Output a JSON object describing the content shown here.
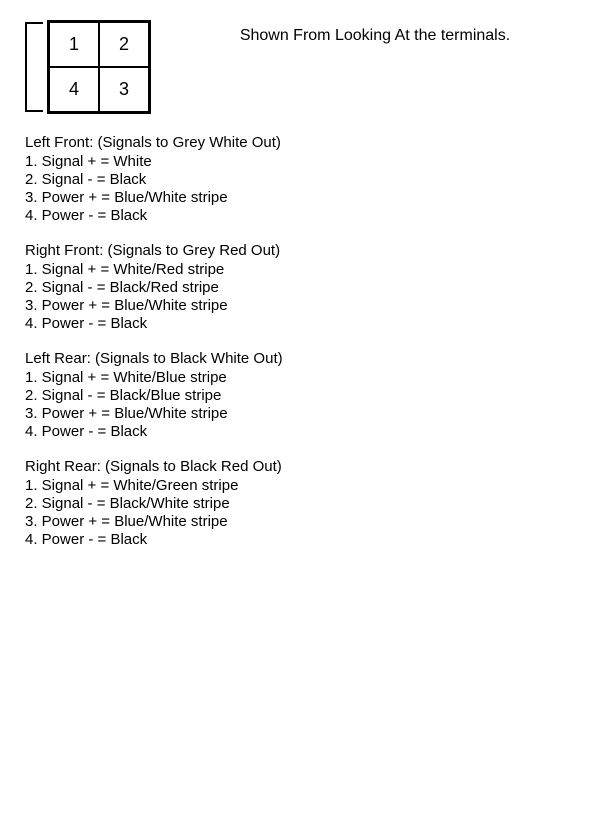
{
  "header": {
    "note": "Shown From Looking At the terminals.",
    "diagram": {
      "cells": [
        "1",
        "2",
        "4",
        "3"
      ]
    }
  },
  "sections": [
    {
      "title": "Left Front: (Signals to Grey White Out)",
      "items": [
        "1. Signal + = White",
        "2. Signal - = Black",
        "3. Power + = Blue/White stripe",
        "4. Power - = Black"
      ]
    },
    {
      "title": "Right Front: (Signals to Grey Red Out)",
      "items": [
        "1. Signal + = White/Red stripe",
        "2. Signal - = Black/Red stripe",
        "3. Power + = Blue/White stripe",
        "4. Power - = Black"
      ]
    },
    {
      "title": "Left Rear: (Signals to Black White Out)",
      "items": [
        "1. Signal + = White/Blue stripe",
        "2. Signal - = Black/Blue stripe",
        "3. Power + = Blue/White stripe",
        "4. Power - = Black"
      ]
    },
    {
      "title": "Right Rear: (Signals to Black Red Out)",
      "items": [
        "1. Signal + = White/Green stripe",
        "2. Signal - = Black/White stripe",
        "3. Power + = Blue/White stripe",
        "4. Power - = Black"
      ]
    }
  ]
}
